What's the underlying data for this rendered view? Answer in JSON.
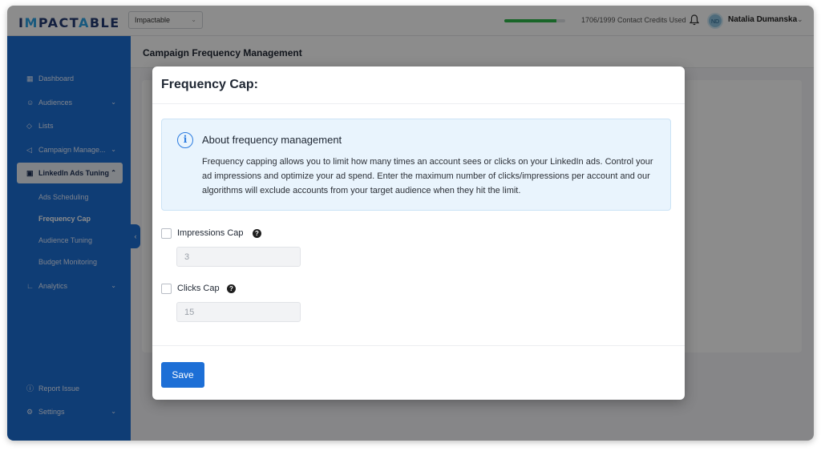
{
  "topbar": {
    "logo": "IMPACTABLE",
    "workspace_select": "Impactable",
    "credits_text": "1706/1999 Contact Credits Used",
    "credits_used_fraction": 0.853,
    "avatar_initials": "ND",
    "user_name": "Natalia Dumanska"
  },
  "sidebar": {
    "items": [
      {
        "label": "Dashboard",
        "icon": "grid-icon"
      },
      {
        "label": "Audiences",
        "icon": "users-icon"
      },
      {
        "label": "Lists",
        "icon": "list-icon"
      },
      {
        "label": "Campaign Manage...",
        "icon": "megaphone-icon"
      },
      {
        "label": "LinkedIn Ads Tuning",
        "icon": "calendar-icon"
      }
    ],
    "sub_items": [
      "Ads Scheduling",
      "Frequency Cap",
      "Audience Tuning",
      "Budget Monitoring"
    ],
    "analytics": "Analytics",
    "report_issue": "Report Issue",
    "settings": "Settings"
  },
  "page": {
    "title": "Campaign Frequency Management"
  },
  "modal": {
    "title": "Frequency Cap:",
    "info_heading": "About frequency management",
    "info_text": "Frequency capping allows you to limit how many times an account sees or clicks on your LinkedIn ads. Control your ad impressions and optimize your ad spend. Enter the maximum number of clicks/impressions per account and our algorithms will exclude accounts from your target audience when they hit the limit.",
    "impressions_label": "Impressions Cap",
    "impressions_value": "3",
    "clicks_label": "Clicks Cap",
    "clicks_value": "15",
    "save_label": "Save"
  },
  "colors": {
    "brand_blue": "#1d6fd6",
    "progress_green": "#2fb84a",
    "info_bg": "#e9f4fd"
  }
}
